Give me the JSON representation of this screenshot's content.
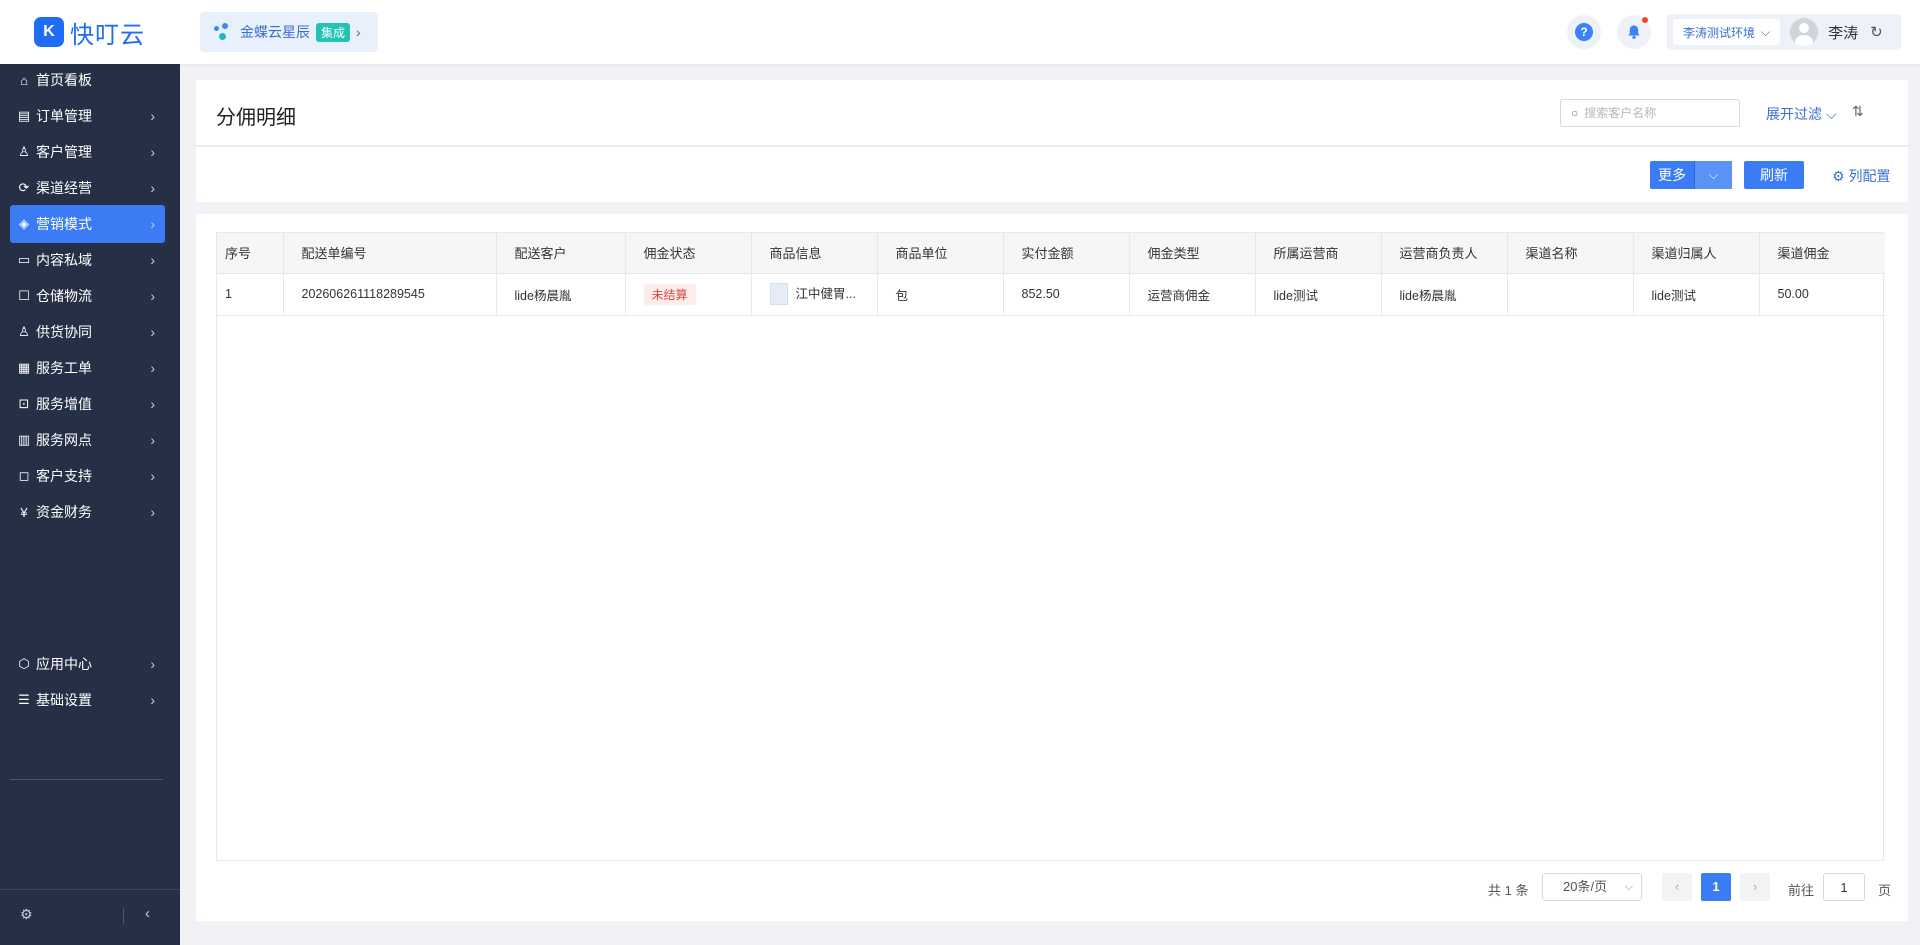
{
  "app": {
    "logo_text": "快叮云",
    "integration_label": "金蝶云星辰",
    "integration_badge": "集成"
  },
  "header": {
    "env_label": "李涛测试环境",
    "user_name": "李涛"
  },
  "sidebar": {
    "items": [
      {
        "label": "首页看板",
        "icon": "home-icon",
        "glyph": "⌂"
      },
      {
        "label": "订单管理",
        "icon": "order-icon",
        "glyph": "▤"
      },
      {
        "label": "客户管理",
        "icon": "user-icon",
        "glyph": "♙"
      },
      {
        "label": "渠道经营",
        "icon": "channel-icon",
        "glyph": "⟳"
      },
      {
        "label": "营销模式",
        "icon": "tag-icon",
        "glyph": "◈"
      },
      {
        "label": "内容私域",
        "icon": "image-icon",
        "glyph": "▭"
      },
      {
        "label": "仓储物流",
        "icon": "box-icon",
        "glyph": "☐"
      },
      {
        "label": "供货协同",
        "icon": "person-link-icon",
        "glyph": "♙"
      },
      {
        "label": "服务工单",
        "icon": "ticket-icon",
        "glyph": "▦"
      },
      {
        "label": "服务增值",
        "icon": "bag-icon",
        "glyph": "⊡"
      },
      {
        "label": "服务网点",
        "icon": "store-icon",
        "glyph": "▥"
      },
      {
        "label": "客户支持",
        "icon": "support-icon",
        "glyph": "◻"
      },
      {
        "label": "资金财务",
        "icon": "yen-icon",
        "glyph": "¥"
      }
    ],
    "bottom_items": [
      {
        "label": "应用中心",
        "icon": "app-center-icon",
        "glyph": "⬡"
      },
      {
        "label": "基础设置",
        "icon": "settings-list-icon",
        "glyph": "☰"
      }
    ],
    "active_index": 4
  },
  "page": {
    "title": "分佣明细",
    "search_placeholder": "搜索客户名称",
    "filter_toggle": "展开过滤",
    "more_label": "更多",
    "refresh_label": "刷新",
    "column_config_label": "列配置"
  },
  "table": {
    "columns": [
      "序号",
      "配送单编号",
      "配送客户",
      "佣金状态",
      "商品信息",
      "商品单位",
      "实付金额",
      "佣金类型",
      "所属运营商",
      "运营商负责人",
      "渠道名称",
      "渠道归属人",
      "渠道佣金"
    ],
    "rows": [
      {
        "seq": "1",
        "delivery_no": "202606261118289545",
        "customer": "lide杨晨胤",
        "status": "未结算",
        "product": "江中健胃...",
        "unit": "包",
        "paid_amount": "852.50",
        "commission_type": "运营商佣金",
        "operator": "lide测试",
        "operator_manager": "lide杨晨胤",
        "channel_name": "",
        "channel_owner": "lide测试",
        "channel_commission": "50.00"
      }
    ]
  },
  "pagination": {
    "total": "共 1 条",
    "page_size": "20条/页",
    "current_page": "1",
    "goto_label": "前往",
    "goto_value": "1",
    "goto_unit": "页"
  },
  "colors": {
    "primary": "#3b7cf5",
    "sidebar_bg": "#253046",
    "status_unsettled": "#e0493a"
  }
}
